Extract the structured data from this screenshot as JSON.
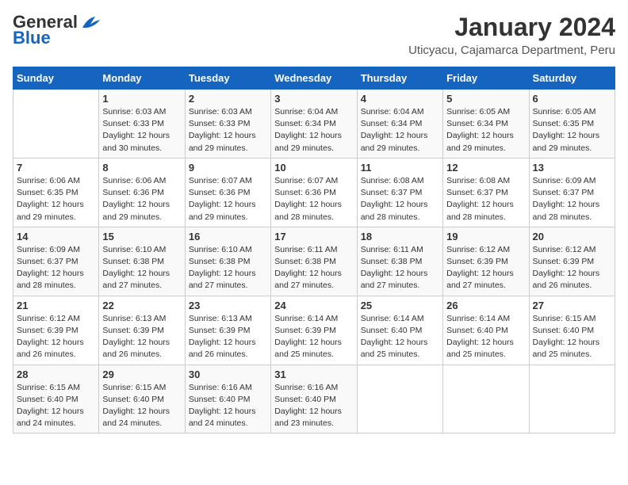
{
  "logo": {
    "general": "General",
    "blue": "Blue"
  },
  "title": "January 2024",
  "subtitle": "Uticyacu, Cajamarca Department, Peru",
  "days_of_week": [
    "Sunday",
    "Monday",
    "Tuesday",
    "Wednesday",
    "Thursday",
    "Friday",
    "Saturday"
  ],
  "weeks": [
    [
      {
        "day": "",
        "info": ""
      },
      {
        "day": "1",
        "info": "Sunrise: 6:03 AM\nSunset: 6:33 PM\nDaylight: 12 hours\nand 30 minutes."
      },
      {
        "day": "2",
        "info": "Sunrise: 6:03 AM\nSunset: 6:33 PM\nDaylight: 12 hours\nand 29 minutes."
      },
      {
        "day": "3",
        "info": "Sunrise: 6:04 AM\nSunset: 6:34 PM\nDaylight: 12 hours\nand 29 minutes."
      },
      {
        "day": "4",
        "info": "Sunrise: 6:04 AM\nSunset: 6:34 PM\nDaylight: 12 hours\nand 29 minutes."
      },
      {
        "day": "5",
        "info": "Sunrise: 6:05 AM\nSunset: 6:34 PM\nDaylight: 12 hours\nand 29 minutes."
      },
      {
        "day": "6",
        "info": "Sunrise: 6:05 AM\nSunset: 6:35 PM\nDaylight: 12 hours\nand 29 minutes."
      }
    ],
    [
      {
        "day": "7",
        "info": "Sunrise: 6:06 AM\nSunset: 6:35 PM\nDaylight: 12 hours\nand 29 minutes."
      },
      {
        "day": "8",
        "info": "Sunrise: 6:06 AM\nSunset: 6:36 PM\nDaylight: 12 hours\nand 29 minutes."
      },
      {
        "day": "9",
        "info": "Sunrise: 6:07 AM\nSunset: 6:36 PM\nDaylight: 12 hours\nand 29 minutes."
      },
      {
        "day": "10",
        "info": "Sunrise: 6:07 AM\nSunset: 6:36 PM\nDaylight: 12 hours\nand 28 minutes."
      },
      {
        "day": "11",
        "info": "Sunrise: 6:08 AM\nSunset: 6:37 PM\nDaylight: 12 hours\nand 28 minutes."
      },
      {
        "day": "12",
        "info": "Sunrise: 6:08 AM\nSunset: 6:37 PM\nDaylight: 12 hours\nand 28 minutes."
      },
      {
        "day": "13",
        "info": "Sunrise: 6:09 AM\nSunset: 6:37 PM\nDaylight: 12 hours\nand 28 minutes."
      }
    ],
    [
      {
        "day": "14",
        "info": "Sunrise: 6:09 AM\nSunset: 6:37 PM\nDaylight: 12 hours\nand 28 minutes."
      },
      {
        "day": "15",
        "info": "Sunrise: 6:10 AM\nSunset: 6:38 PM\nDaylight: 12 hours\nand 27 minutes."
      },
      {
        "day": "16",
        "info": "Sunrise: 6:10 AM\nSunset: 6:38 PM\nDaylight: 12 hours\nand 27 minutes."
      },
      {
        "day": "17",
        "info": "Sunrise: 6:11 AM\nSunset: 6:38 PM\nDaylight: 12 hours\nand 27 minutes."
      },
      {
        "day": "18",
        "info": "Sunrise: 6:11 AM\nSunset: 6:38 PM\nDaylight: 12 hours\nand 27 minutes."
      },
      {
        "day": "19",
        "info": "Sunrise: 6:12 AM\nSunset: 6:39 PM\nDaylight: 12 hours\nand 27 minutes."
      },
      {
        "day": "20",
        "info": "Sunrise: 6:12 AM\nSunset: 6:39 PM\nDaylight: 12 hours\nand 26 minutes."
      }
    ],
    [
      {
        "day": "21",
        "info": "Sunrise: 6:12 AM\nSunset: 6:39 PM\nDaylight: 12 hours\nand 26 minutes."
      },
      {
        "day": "22",
        "info": "Sunrise: 6:13 AM\nSunset: 6:39 PM\nDaylight: 12 hours\nand 26 minutes."
      },
      {
        "day": "23",
        "info": "Sunrise: 6:13 AM\nSunset: 6:39 PM\nDaylight: 12 hours\nand 26 minutes."
      },
      {
        "day": "24",
        "info": "Sunrise: 6:14 AM\nSunset: 6:39 PM\nDaylight: 12 hours\nand 25 minutes."
      },
      {
        "day": "25",
        "info": "Sunrise: 6:14 AM\nSunset: 6:40 PM\nDaylight: 12 hours\nand 25 minutes."
      },
      {
        "day": "26",
        "info": "Sunrise: 6:14 AM\nSunset: 6:40 PM\nDaylight: 12 hours\nand 25 minutes."
      },
      {
        "day": "27",
        "info": "Sunrise: 6:15 AM\nSunset: 6:40 PM\nDaylight: 12 hours\nand 25 minutes."
      }
    ],
    [
      {
        "day": "28",
        "info": "Sunrise: 6:15 AM\nSunset: 6:40 PM\nDaylight: 12 hours\nand 24 minutes."
      },
      {
        "day": "29",
        "info": "Sunrise: 6:15 AM\nSunset: 6:40 PM\nDaylight: 12 hours\nand 24 minutes."
      },
      {
        "day": "30",
        "info": "Sunrise: 6:16 AM\nSunset: 6:40 PM\nDaylight: 12 hours\nand 24 minutes."
      },
      {
        "day": "31",
        "info": "Sunrise: 6:16 AM\nSunset: 6:40 PM\nDaylight: 12 hours\nand 23 minutes."
      },
      {
        "day": "",
        "info": ""
      },
      {
        "day": "",
        "info": ""
      },
      {
        "day": "",
        "info": ""
      }
    ]
  ]
}
